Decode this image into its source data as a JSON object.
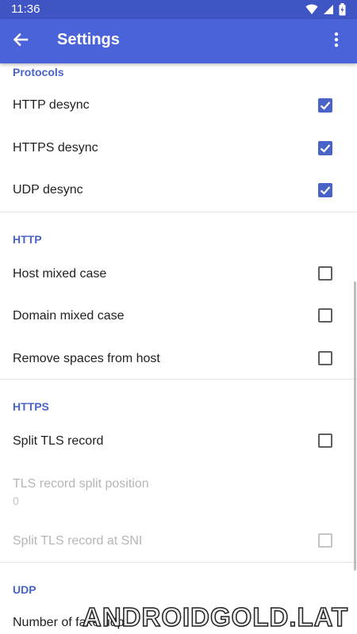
{
  "status_bar": {
    "time": "11:36"
  },
  "app_bar": {
    "title": "Settings"
  },
  "sections": {
    "protocols": {
      "title": "Protocols",
      "items": [
        {
          "label": "HTTP desync",
          "checked": true
        },
        {
          "label": "HTTPS desync",
          "checked": true
        },
        {
          "label": "UDP desync",
          "checked": true
        }
      ]
    },
    "http": {
      "title": "HTTP",
      "items": [
        {
          "label": "Host mixed case",
          "checked": false
        },
        {
          "label": "Domain mixed case",
          "checked": false
        },
        {
          "label": "Remove spaces from host",
          "checked": false
        }
      ]
    },
    "https": {
      "title": "HTTPS",
      "split_tls": {
        "label": "Split TLS record",
        "checked": false
      },
      "split_position": {
        "label": "TLS record split position",
        "value": "0"
      },
      "split_at_sni": {
        "label": "Split TLS record at SNI",
        "checked": false
      }
    },
    "udp": {
      "title": "UDP",
      "fake_udp": {
        "label": "Number of fake udp"
      }
    }
  },
  "watermark": "ANDROIDGOLD.LAT",
  "colors": {
    "app_bar": "#4b63d8",
    "status_bar": "#4055c4",
    "accent": "#4a63c8"
  }
}
